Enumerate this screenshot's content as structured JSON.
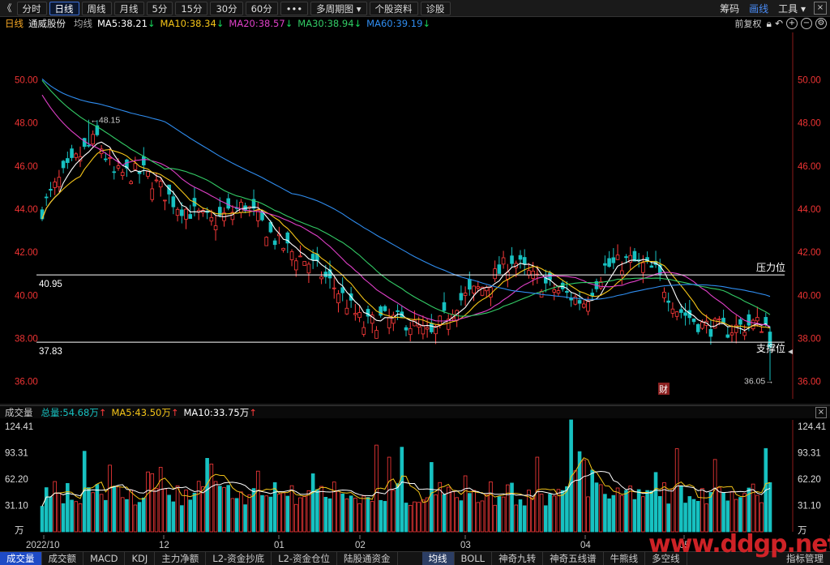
{
  "toolbar": {
    "back": "《",
    "tabs": [
      "分时",
      "日线",
      "周线",
      "月线",
      "5分",
      "15分",
      "30分",
      "60分",
      "•••",
      "多周期图 ▾",
      "个股资料",
      "诊股"
    ],
    "active_index": 1,
    "right": [
      "筹码",
      "画线",
      "工具 ▾"
    ],
    "right_active_index": 1,
    "close": "×"
  },
  "info": {
    "period": "日线",
    "stock_name": "通威股份",
    "avg_label": "均线",
    "ma5": "MA5:38.21",
    "ma10": "MA10:38.34",
    "ma20": "MA20:38.57",
    "ma30": "MA30:38.94",
    "ma60": "MA60:39.19",
    "arrow_down": "↓",
    "adjust": "前复权",
    "colors": {
      "ma5": "#ffffff",
      "ma10": "#f5c518",
      "ma20": "#e040c8",
      "ma30": "#33cc66",
      "ma60": "#2f8df0",
      "up": "#ff3b3b",
      "down": "#17c1c1"
    }
  },
  "chart_data": {
    "type": "candlestick",
    "y_ticks": [
      "50.00",
      "48.00",
      "46.00",
      "44.00",
      "42.00",
      "40.00",
      "38.00",
      "36.00"
    ],
    "y_values": [
      50,
      48,
      46,
      44,
      42,
      40,
      38,
      36
    ],
    "ylim": [
      35.2,
      52.2
    ],
    "x_ticks": [
      "2022/10",
      "12",
      "01",
      "02",
      "03",
      "04",
      "05"
    ],
    "resistance": {
      "value": 40.95,
      "label": "40.95",
      "name": "压力位"
    },
    "support": {
      "value": 37.83,
      "label": "37.83",
      "name": "支撑位"
    },
    "high_mark": {
      "value": 48.15,
      "label": "←48.15"
    },
    "low_mark": {
      "value": 36.05,
      "label": "36.05→"
    },
    "finance_badge": "财",
    "n": 173
  },
  "volume": {
    "title": "成交量",
    "total": "总量:54.68万",
    "ma5": "MA5:43.50万",
    "ma10": "MA10:33.75万",
    "arrow_up": "↑",
    "y_ticks": [
      "124.41",
      "93.31",
      "62.20",
      "31.10"
    ],
    "y_values": [
      124.41,
      93.31,
      62.2,
      31.1
    ],
    "unit": "万"
  },
  "bottom": {
    "tabs": [
      "成交量",
      "成交额",
      "MACD",
      "KDJ",
      "主力净额",
      "L2-资金抄底",
      "L2-资金仓位",
      "陆股通资金"
    ],
    "overlays": [
      "均线",
      "BOLL",
      "神奇九转",
      "神奇五线谱",
      "牛熊线",
      "多空线"
    ],
    "manage": "指标管理"
  },
  "watermark": "www.ddgp.net"
}
